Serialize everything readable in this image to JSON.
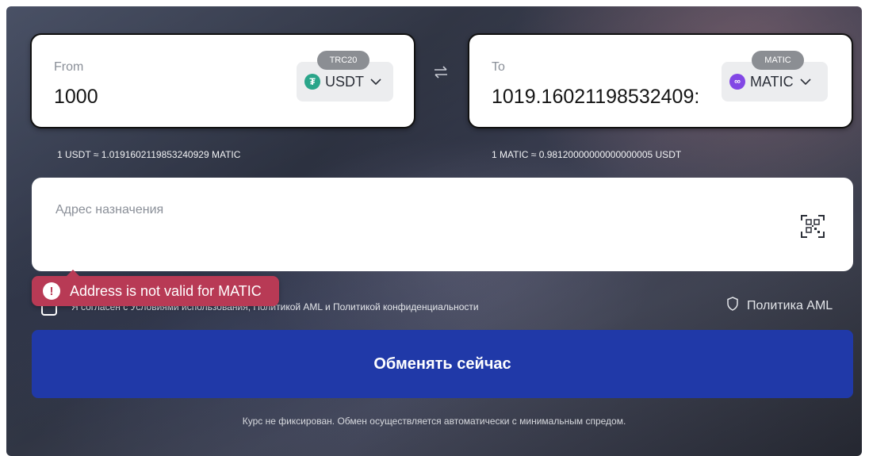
{
  "from": {
    "label": "From",
    "amount": "1000",
    "network_badge": "TRC20",
    "token": "USDT",
    "token_icon": "usdt-coin-icon"
  },
  "to": {
    "label": "To",
    "amount": "1019.16021198532409:",
    "network_badge": "MATIC",
    "token": "MATIC",
    "token_icon": "matic-coin-icon"
  },
  "rates": {
    "left": "1 USDT ≈ 1.0191602119853240929 MATIC",
    "right": "1 MATIC ≈ 0.98120000000000000005 USDT"
  },
  "address": {
    "placeholder": "Адрес назначения"
  },
  "error": {
    "message": "Address is not valid for MATIC"
  },
  "consent": {
    "text": "Я согласен с Условиями использования, Политикой AML и Политикой конфиденциальности"
  },
  "aml_policy": {
    "label": "Политика AML"
  },
  "exchange_button": {
    "label": "Обменять сейчас"
  },
  "footer": {
    "note": "Курс не фиксирован. Обмен осуществляется автоматически с минимальным спредом."
  },
  "colors": {
    "primary_button": "#2039a8",
    "error": "#b83a55",
    "usdt": "#2aa58a",
    "matic": "#8247e5"
  }
}
